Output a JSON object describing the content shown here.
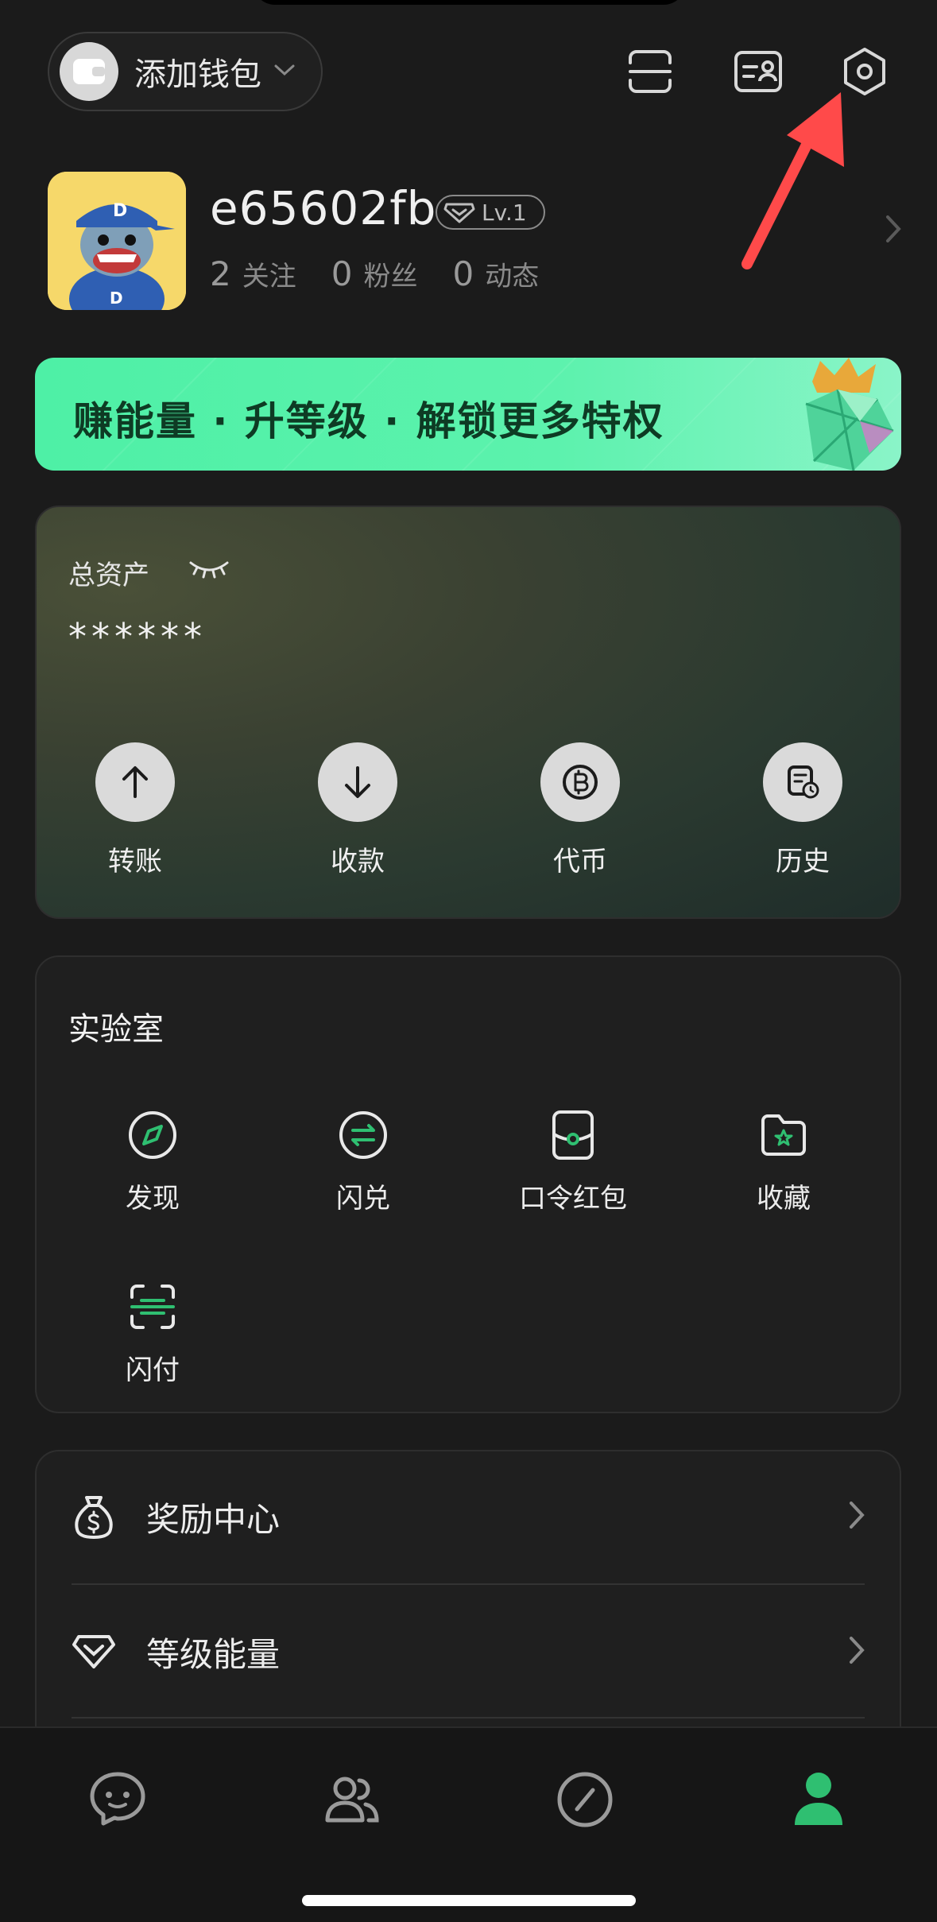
{
  "header": {
    "wallet_label": "添加钱包"
  },
  "profile": {
    "username": "e65602fb",
    "level": "Lv.1",
    "stats": [
      {
        "count": "2",
        "label": "关注"
      },
      {
        "count": "0",
        "label": "粉丝"
      },
      {
        "count": "0",
        "label": "动态"
      }
    ]
  },
  "promo": {
    "text": "赚能量 · 升等级 · 解锁更多特权"
  },
  "assets": {
    "label": "总资产",
    "value": "******",
    "actions": [
      {
        "label": "转账",
        "icon": "arrow-up-icon"
      },
      {
        "label": "收款",
        "icon": "arrow-down-icon"
      },
      {
        "label": "代币",
        "icon": "bitcoin-icon"
      },
      {
        "label": "历史",
        "icon": "history-icon"
      }
    ]
  },
  "lab": {
    "title": "实验室",
    "tools": [
      {
        "label": "发现",
        "icon": "compass-icon"
      },
      {
        "label": "闪兑",
        "icon": "swap-icon"
      },
      {
        "label": "口令红包",
        "icon": "red-packet-icon"
      },
      {
        "label": "收藏",
        "icon": "favorites-folder-icon"
      },
      {
        "label": "闪付",
        "icon": "scan-pay-icon"
      }
    ]
  },
  "menu": {
    "items": [
      {
        "label": "奖励中心",
        "icon": "money-bag-icon"
      },
      {
        "label": "等级能量",
        "icon": "level-diamond-icon"
      }
    ]
  },
  "bottom_nav": {
    "items": [
      {
        "name": "chat",
        "icon": "chat-icon",
        "active": false
      },
      {
        "name": "contacts",
        "icon": "contacts-icon",
        "active": false
      },
      {
        "name": "discover",
        "icon": "discover-icon",
        "active": false
      },
      {
        "name": "profile",
        "icon": "profile-icon",
        "active": true
      }
    ]
  },
  "colors": {
    "accent": "#2fbf71",
    "background": "#1b1b1b",
    "annotation": "#ff4a4a"
  }
}
